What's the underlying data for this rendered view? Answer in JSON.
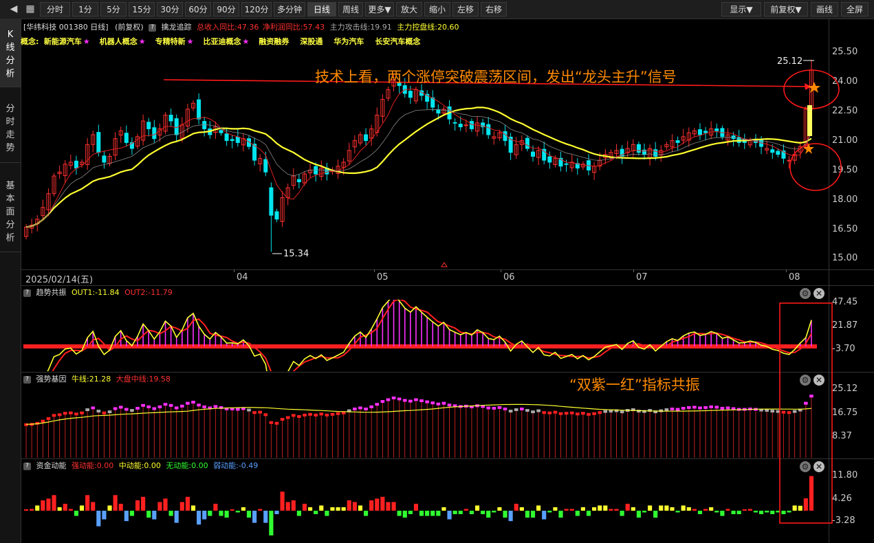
{
  "toolbar": {
    "buttons": [
      {
        "label": "分时"
      },
      {
        "label": "1分"
      },
      {
        "label": "5分"
      },
      {
        "label": "15分"
      },
      {
        "label": "30分"
      },
      {
        "label": "60分"
      },
      {
        "label": "90分"
      },
      {
        "label": "120分"
      },
      {
        "label": "多分钟"
      },
      {
        "label": "日线"
      },
      {
        "label": "周线"
      },
      {
        "label": "更多▼"
      },
      {
        "label": "放大"
      },
      {
        "label": "缩小"
      },
      {
        "label": "左移"
      },
      {
        "label": "右移"
      }
    ],
    "right_buttons": [
      {
        "label": "显示▼"
      },
      {
        "label": "前复权▼"
      },
      {
        "label": "画线"
      },
      {
        "label": "全屏"
      }
    ]
  },
  "sidebar": {
    "tabs": [
      {
        "label": "K线分析",
        "lines": [
          "K",
          "线",
          "分",
          "析"
        ]
      },
      {
        "label": "分时走势",
        "lines": [
          "分",
          "时",
          "走",
          "势"
        ]
      },
      {
        "label": "基本面分析",
        "lines": [
          "基",
          "本",
          "面",
          "分",
          "析"
        ]
      }
    ]
  },
  "stock": {
    "title": "[华纬科技 001380 日线]",
    "adjust": "(前复权)",
    "indicator_name": "擒龙追踪",
    "revenue_yoy": "总收入同比:47.36",
    "profit_yoy": "净利润同比:57.43",
    "attack_line": "主力攻击线:19.91",
    "control_line": "主力控盘线:20.60"
  },
  "concepts": {
    "label": "概念:",
    "items": [
      {
        "text": "新能源汽车",
        "star": "★"
      },
      {
        "text": "机器人概念",
        "star": "★"
      },
      {
        "text": "专精特新",
        "star": "★"
      },
      {
        "text": "比亚迪概念",
        "star": "★"
      },
      {
        "text": "融资融券",
        "star": ""
      },
      {
        "text": "深股通",
        "star": ""
      },
      {
        "text": "华为汽车",
        "star": ""
      },
      {
        "text": "长安汽车概念",
        "star": ""
      }
    ]
  },
  "annotations": {
    "tech_note": "技术上看，两个涨停突破震荡区间，发出“龙头主升”信号",
    "resonance_note": "“双紫一红”指标共振",
    "high_label": "25.12",
    "low_label": "15.34"
  },
  "price_axis": {
    "ticks": [
      "25.50",
      "24.00",
      "22.50",
      "21.00",
      "19.50",
      "18.00",
      "16.50",
      "15.00"
    ]
  },
  "date_axis": {
    "start": "2025/02/14(五)",
    "months": [
      "04",
      "05",
      "06",
      "07",
      "08"
    ]
  },
  "panel_trend": {
    "name": "趋势共振",
    "out1": "OUT1:-11.84",
    "out2": "OUT2:-11.79",
    "ticks": [
      "47.45",
      "21.87",
      "-3.70"
    ]
  },
  "panel_strength": {
    "name": "强势基因",
    "bull": "牛线:21.28",
    "market": "大盘中线:19.58",
    "ticks": [
      "25.12",
      "16.75",
      "8.37"
    ]
  },
  "panel_capital": {
    "name": "资金动能",
    "strong": "强动能:0.00",
    "mid": "中动能:0.00",
    "none": "无动能:0.00",
    "weak": "弱动能:-0.49",
    "ticks": [
      "11.80",
      "4.26",
      "-3.28"
    ]
  },
  "colors": {
    "up": "#ff3030",
    "down": "#00e5ee",
    "ma_yellow": "#ffff30",
    "ma_red": "#e02020",
    "magenta": "#ff30ff",
    "annotation_orange": "#ff8a00",
    "concept_yellow": "#ffff40"
  },
  "chart_data": {
    "type": "candlestick",
    "title": "华纬科技 001380 日线",
    "ylim": [
      15.0,
      25.5
    ],
    "y_ticks": [
      25.5,
      24.0,
      22.5,
      21.0,
      19.5,
      18.0,
      16.5,
      15.0
    ],
    "x_labels": [
      "2025/02/14(五)",
      "04",
      "05",
      "06",
      "07",
      "08"
    ],
    "high": 25.12,
    "low": 15.34,
    "last_attack_line": 19.91,
    "last_control_line": 20.6,
    "closes": [
      16.6,
      16.7,
      17.0,
      17.6,
      18.3,
      19.2,
      19.4,
      19.8,
      19.9,
      19.6,
      19.9,
      20.8,
      21.3,
      20.4,
      19.9,
      20.2,
      21.1,
      21.5,
      20.9,
      20.6,
      21.2,
      22.0,
      21.6,
      21.1,
      21.6,
      22.3,
      22.0,
      21.3,
      21.8,
      22.6,
      22.9,
      22.1,
      21.6,
      21.3,
      21.7,
      21.4,
      21.0,
      21.0,
      20.9,
      21.1,
      20.7,
      20.0,
      20.1,
      19.4,
      17.2,
      17.0,
      18.1,
      18.6,
      19.2,
      18.9,
      19.3,
      19.5,
      19.3,
      19.6,
      19.3,
      19.5,
      19.7,
      19.9,
      20.5,
      21.0,
      21.3,
      21.0,
      21.6,
      22.3,
      23.1,
      23.6,
      24.1,
      23.8,
      23.4,
      23.2,
      23.6,
      23.3,
      23.0,
      22.7,
      22.4,
      22.6,
      22.1,
      21.9,
      21.7,
      21.8,
      21.6,
      21.9,
      21.7,
      21.3,
      21.2,
      21.4,
      21.0,
      20.4,
      20.8,
      21.0,
      20.6,
      20.2,
      20.5,
      20.0,
      19.9,
      20.1,
      19.7,
      19.8,
      19.9,
      19.6,
      19.8,
      19.5,
      19.7,
      20.0,
      20.3,
      20.4,
      20.5,
      20.2,
      20.6,
      20.8,
      20.4,
      20.3,
      20.6,
      20.2,
      20.5,
      20.8,
      21.0,
      20.9,
      21.2,
      21.4,
      21.5,
      21.3,
      21.4,
      21.6,
      21.5,
      21.2,
      21.3,
      21.1,
      20.9,
      20.9,
      21.0,
      20.9,
      20.7,
      20.6,
      20.4,
      20.3,
      20.1,
      20.0,
      20.3,
      20.7,
      22.6,
      24.6
    ]
  }
}
